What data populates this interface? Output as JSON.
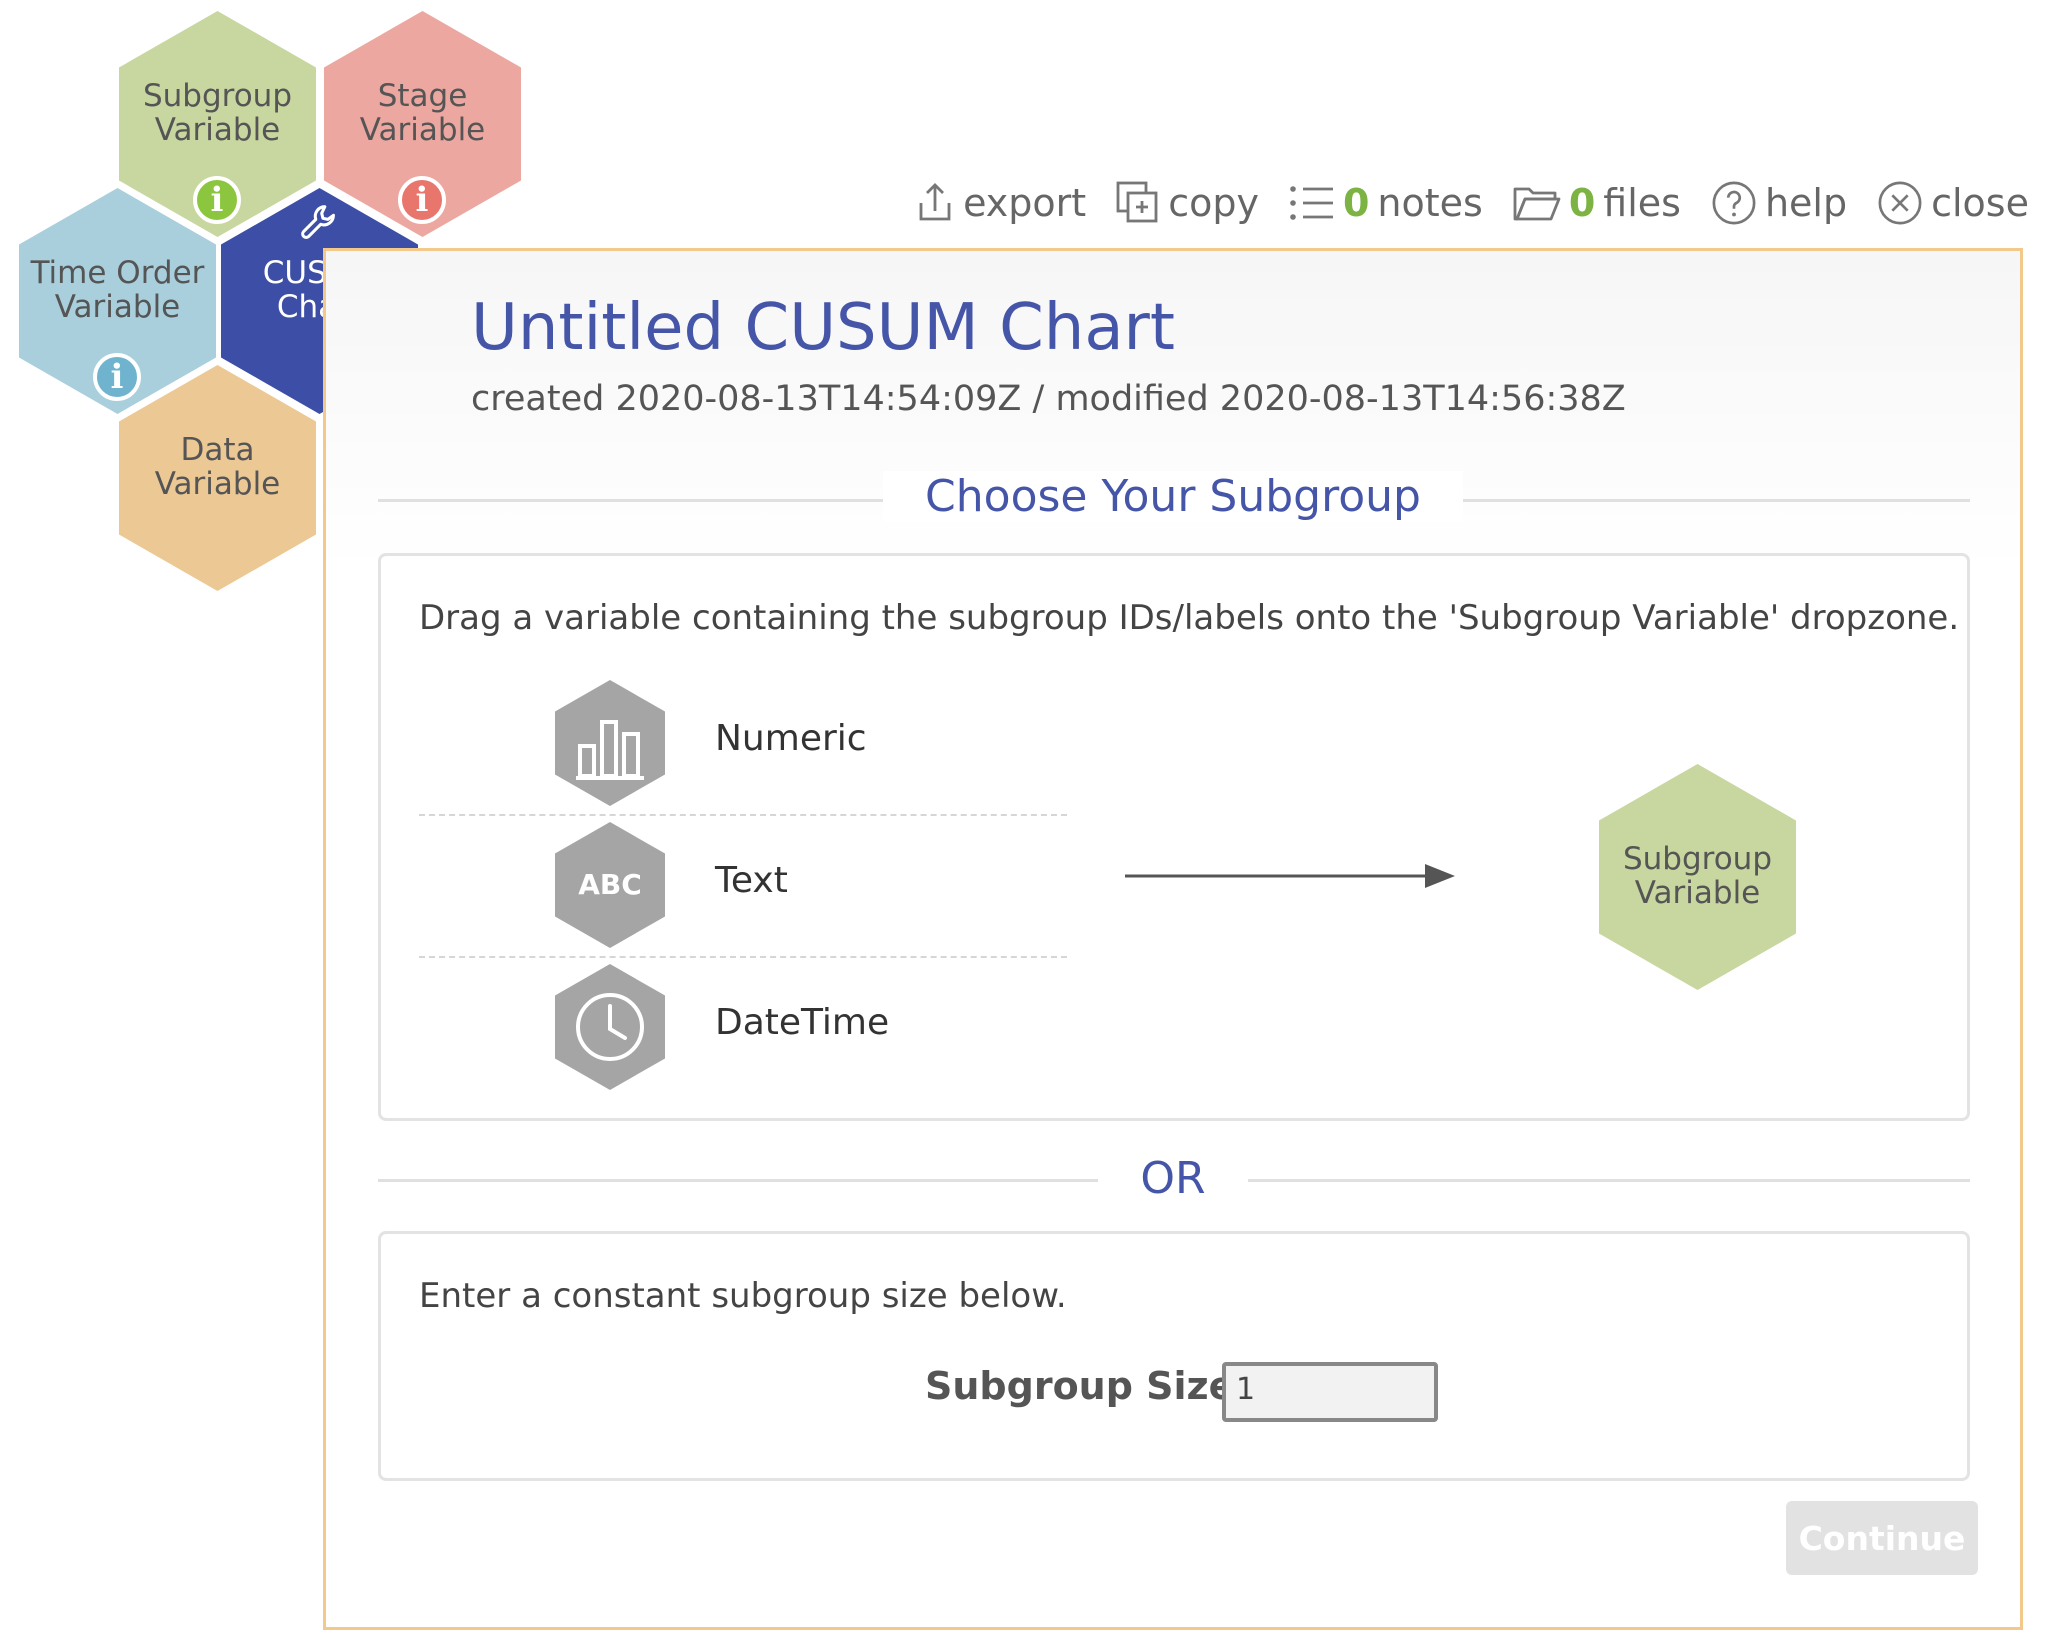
{
  "hex_nav": {
    "subgroup_variable": {
      "label": "Subgroup\nVariable",
      "color": "#c8d6a0",
      "badge_color": "#8cc63f"
    },
    "stage_variable": {
      "label": "Stage\nVariable",
      "color": "#eba7a0",
      "badge_color": "#e8766c"
    },
    "time_order_variable": {
      "label": "Time Order\nVariable",
      "color": "#a9cfdc",
      "badge_color": "#6fb3cf"
    },
    "cusum_chart": {
      "label": "CUSUM\nChart",
      "color": "#3c4ea5"
    },
    "data_variable": {
      "label": "Data\nVariable",
      "color": "#ecc895"
    }
  },
  "toolbar": {
    "export_label": "export",
    "copy_label": "copy",
    "notes_count": "0",
    "notes_label": "notes",
    "files_count": "0",
    "files_label": "files",
    "help_label": "help",
    "close_label": "close"
  },
  "panel": {
    "title": "Untitled CUSUM Chart",
    "meta": "created 2020-08-13T14:54:09Z / modified 2020-08-13T14:56:38Z"
  },
  "subgroup_section": {
    "heading": "Choose Your Subgroup",
    "instruction": "Drag a variable containing the subgroup IDs/labels onto the 'Subgroup Variable' dropzone.",
    "types": [
      {
        "label": "Numeric",
        "icon": "bar-chart-icon"
      },
      {
        "label": "Text",
        "icon": "abc-icon",
        "icon_text": "ABC"
      },
      {
        "label": "DateTime",
        "icon": "clock-icon"
      }
    ],
    "dropzone_label": "Subgroup\nVariable",
    "dropzone_color": "#c8d6a0"
  },
  "or_label": "OR",
  "constant_section": {
    "instruction": "Enter a constant subgroup size below.",
    "size_label": "Subgroup Size",
    "size_value": "1"
  },
  "continue_label": "Continue",
  "colors": {
    "accent": "#4555a8",
    "panel_border": "#f2c98a",
    "count_green": "#7cb342"
  }
}
